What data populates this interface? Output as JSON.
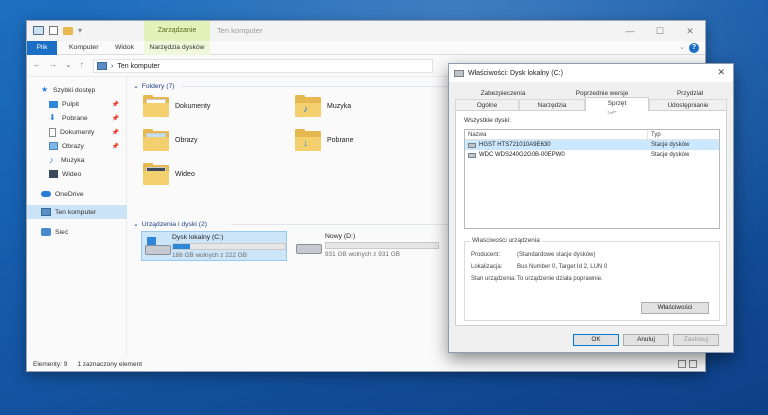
{
  "explorer": {
    "title": "Ten komputer",
    "context_tab": "Zarządzanie",
    "ribbon": {
      "plik": "Plik",
      "komputer": "Komputer",
      "widok": "Widok",
      "tools": "Narzędzia dysków"
    },
    "address": {
      "path": "Ten komputer"
    },
    "nav_pane": {
      "quick_access": "Szybki dostęp",
      "items": [
        {
          "label": "Pulpit",
          "icon": "desktop-icon"
        },
        {
          "label": "Pobrane",
          "icon": "download-icon"
        },
        {
          "label": "Dokumenty",
          "icon": "document-icon"
        },
        {
          "label": "Obrazy",
          "icon": "pictures-icon"
        },
        {
          "label": "Muzyka",
          "icon": "music-icon"
        },
        {
          "label": "Wideo",
          "icon": "video-icon"
        }
      ],
      "onedrive": "OneDrive",
      "this_pc": "Ten komputer",
      "network": "Sieć"
    },
    "folders_header": "Foldery (7)",
    "folders": [
      {
        "name": "Dokumenty"
      },
      {
        "name": "Muzyka"
      },
      {
        "name": "Obrazy"
      },
      {
        "name": "Pobrane"
      },
      {
        "name": "Wideo"
      }
    ],
    "drives_header": "Urządzenia i dyski (2)",
    "drives": [
      {
        "name": "Dysk lokalny (C:)",
        "free": "188 GB wolnych z 222 GB",
        "used_fraction": 0.15
      },
      {
        "name": "Nowy (D:)",
        "free": "931 GB wolnych z 931 GB",
        "used_fraction": 0.0
      }
    ],
    "status": {
      "items": "Elementy: 9",
      "selected": "1 zaznaczony element"
    }
  },
  "dialog": {
    "title": "Właściwości: Dysk lokalny (C:)",
    "tabs_row1": [
      "Zabezpieczenia",
      "Poprzednie wersje",
      "Przydział"
    ],
    "tabs_row2": [
      "Ogólne",
      "Narzędzia",
      "Sprzęt",
      "Udostępnianie"
    ],
    "all_disks_label": "Wszystkie dyski:",
    "columns": {
      "name": "Nazwa",
      "type": "Typ"
    },
    "disks": [
      {
        "name": "HGST HTS721010A9E630",
        "type": "Stacje dysków"
      },
      {
        "name": "WDC WDS240G2G0B-00EPW0",
        "type": "Stacje dysków"
      }
    ],
    "props_title": "Właściwości urządzenia",
    "props": [
      {
        "key": "Producent:",
        "value": "(Standardowe stacje dysków)"
      },
      {
        "key": "Lokalizacja:",
        "value": "Bus Number 0, Target Id 2, LUN 0"
      },
      {
        "key": "Stan urządzenia:",
        "value": "To urządzenie działa poprawnie."
      }
    ],
    "btn_properties": "Właściwości",
    "btn_ok": "OK",
    "btn_cancel": "Anuluj",
    "btn_apply": "Zastosuj"
  }
}
